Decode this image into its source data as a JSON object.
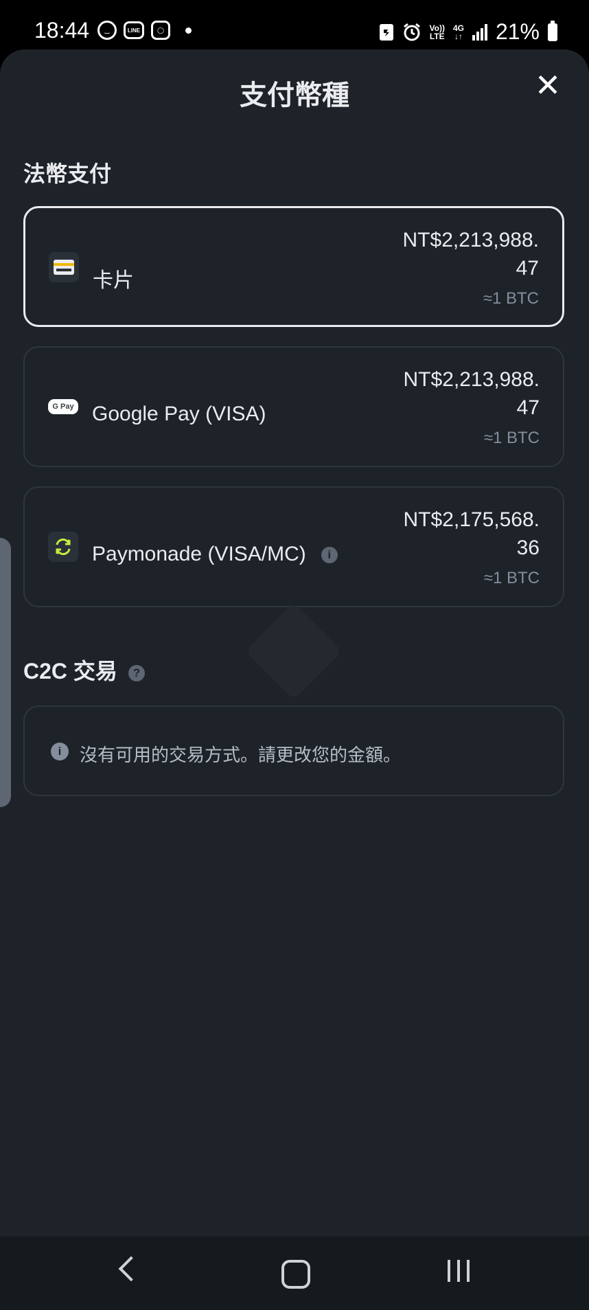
{
  "status_bar": {
    "time": "18:44",
    "left_icons": [
      "smile-icon",
      "line-icon",
      "instagram-icon"
    ],
    "line_label": "LINE",
    "volte_top": "Vo))",
    "volte_bottom": "LTE",
    "network_top": "4G",
    "network_bottom": "↓↑",
    "battery": "21%"
  },
  "sheet": {
    "title": "支付幣種",
    "close_label": "✕"
  },
  "fiat": {
    "section_title": "法幣支付",
    "methods": [
      {
        "name": "卡片",
        "price_line1": "NT$2,213,988.",
        "price_line2": "47",
        "approx": "≈1 BTC",
        "icon": "card-icon",
        "selected": true
      },
      {
        "name": "Google Pay (VISA)",
        "price_line1": "NT$2,213,988.",
        "price_line2": "47",
        "approx": "≈1 BTC",
        "icon": "google-pay-icon",
        "icon_text": "G Pay",
        "selected": false
      },
      {
        "name": "Paymonade (VISA/MC)",
        "price_line1": "NT$2,175,568.",
        "price_line2": "36",
        "approx": "≈1 BTC",
        "icon": "paymonade-icon",
        "selected": false
      }
    ]
  },
  "c2c": {
    "section_title": "C2C 交易",
    "help_icon": "?",
    "empty_message": "沒有可用的交易方式。請更改您的金額。",
    "info_icon": "i"
  },
  "colors": {
    "background": "#1e2329",
    "accent_yellow": "#f0b90b",
    "text_primary": "#eaecef",
    "text_secondary": "#848e9c"
  }
}
